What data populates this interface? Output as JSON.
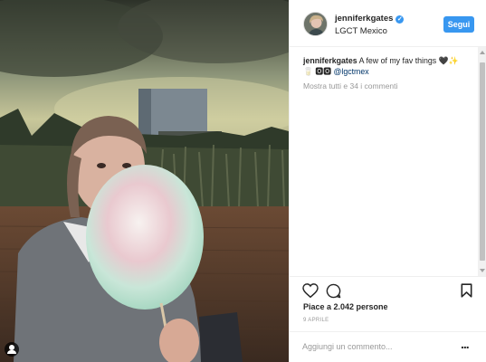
{
  "post": {
    "photo_alt": "",
    "tag_icon": "user-tag-icon"
  },
  "header": {
    "username": "jenniferkgates",
    "verified_icon": "verified-check-icon",
    "verified_glyph": "✓",
    "location": "LGCT Mexico",
    "follow_label": "Segui"
  },
  "caption": {
    "user": "jenniferkgates",
    "text": " A few of my fav things 🖤✨\n🥛 🅾🅾 ",
    "mention": "@lgctmex"
  },
  "comments": {
    "more_label": "Mostra tutti e 34 i commenti"
  },
  "actions": {
    "like_icon": "heart-icon",
    "comment_icon": "comment-bubble-icon",
    "save_icon": "bookmark-icon"
  },
  "likes_text": "Piace a 2.042 persone",
  "date_text": "9 APRILE",
  "comment_box": {
    "placeholder": "Aggiungi un commento...",
    "more_glyph": "..."
  },
  "colors": {
    "accent": "#3897f0",
    "text": "#262626",
    "muted": "#999999",
    "border": "#efefef",
    "mention": "#003569"
  }
}
